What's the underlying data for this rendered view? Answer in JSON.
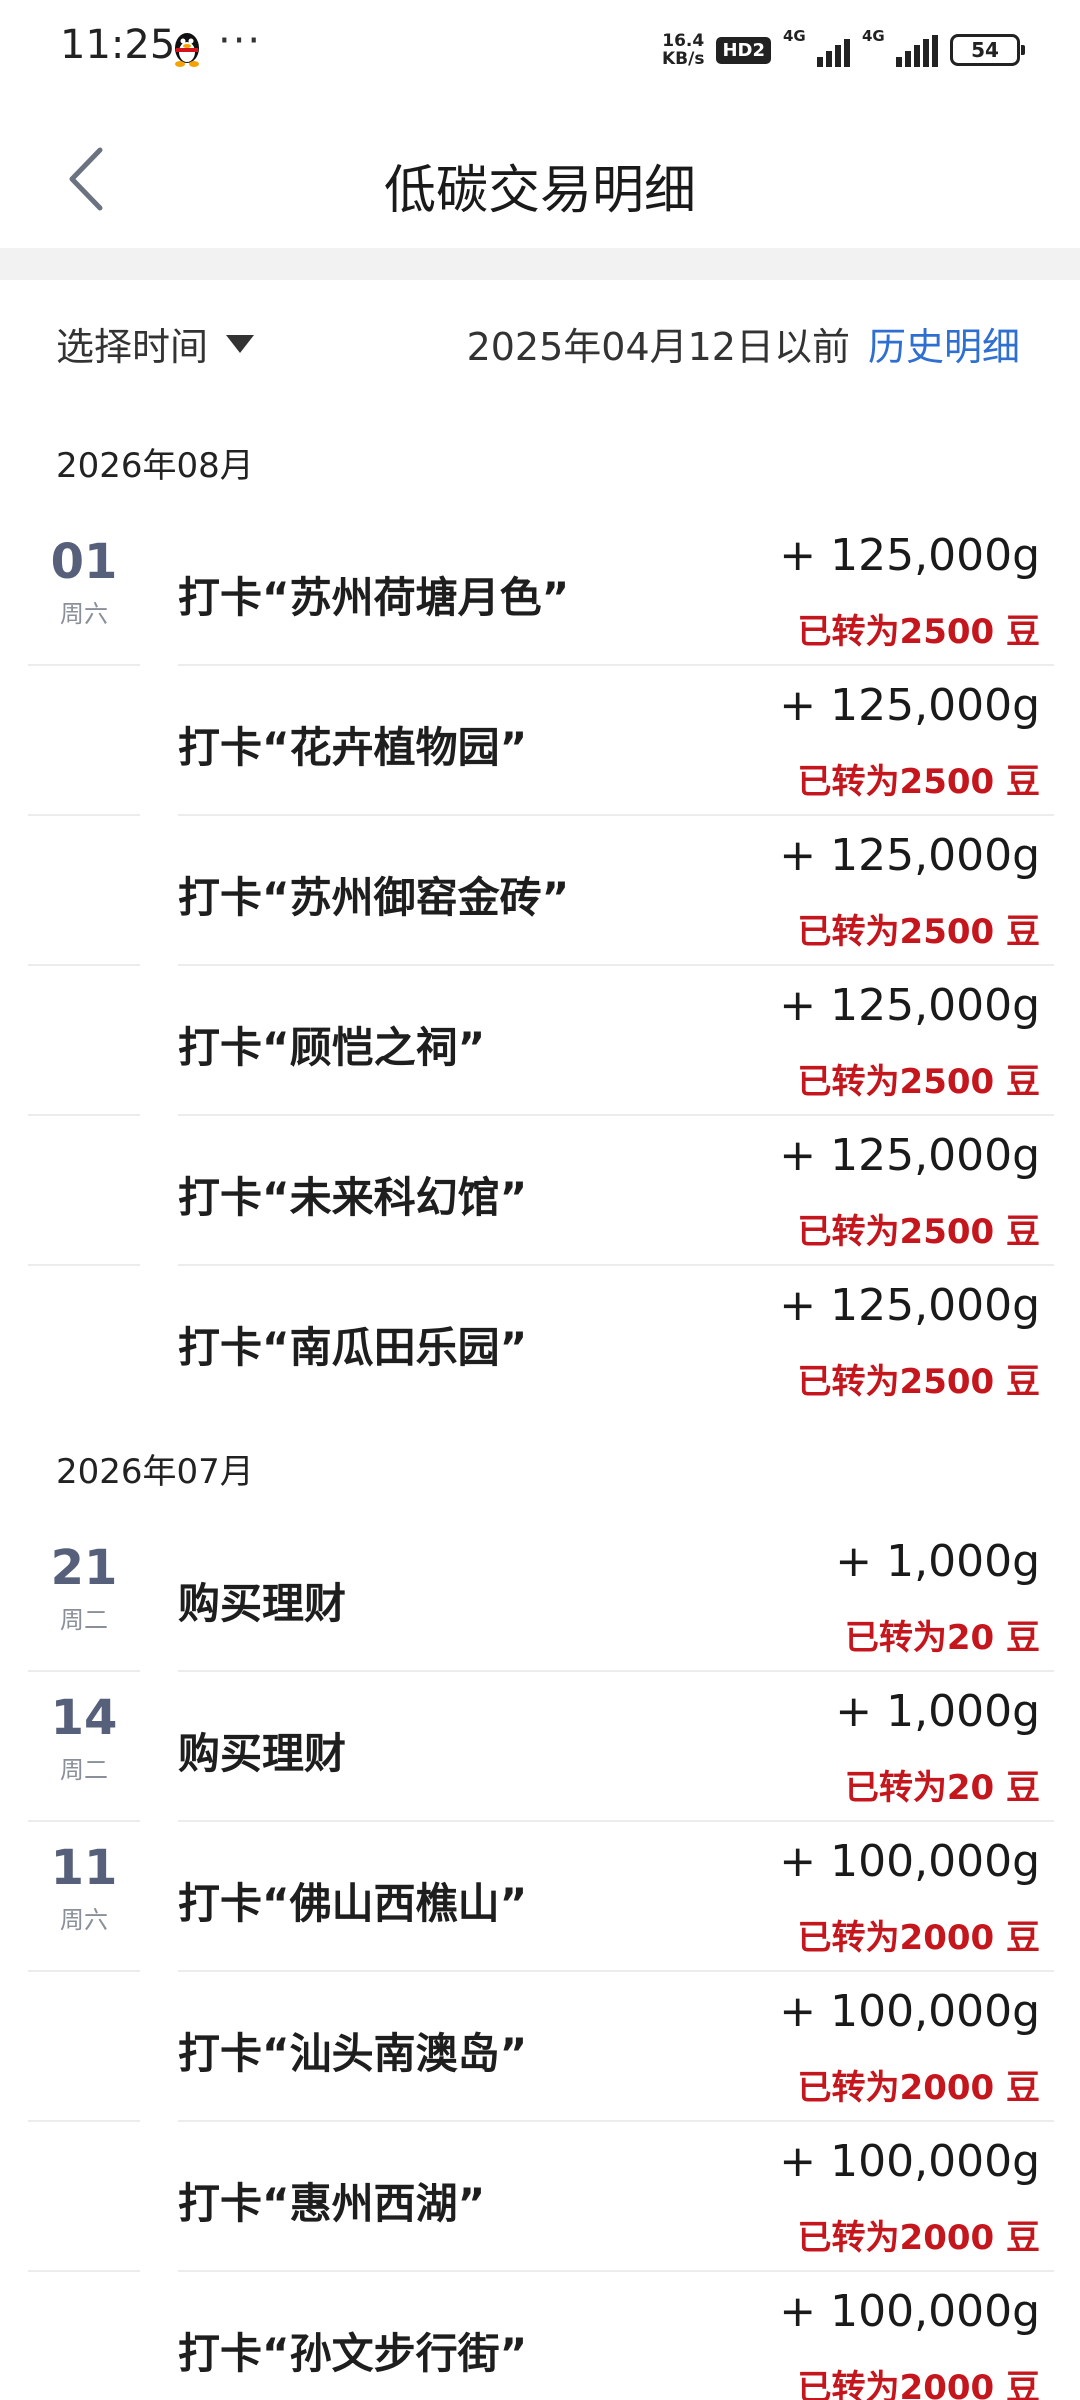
{
  "status_bar": {
    "time": "11:25",
    "speed_value": "16.4",
    "speed_unit": "KB/s",
    "hd_badge": "HD2",
    "network1": "4G",
    "network2": "4G",
    "battery": "54",
    "more": "···"
  },
  "nav": {
    "title": "低碳交易明细",
    "back_icon": "chevron-left-icon"
  },
  "filter": {
    "select_label": "选择时间",
    "date_text": "2025年04月12日以前",
    "history_link": "历史明细"
  },
  "colors": {
    "accent_link": "#2e6fd1",
    "converted_red": "#c4161c",
    "date_number": "#56607a"
  },
  "months": [
    {
      "label": "2026年08月",
      "entries": [
        {
          "day": "01",
          "week": "周六",
          "title": "打卡“苏州荷塘月色”",
          "amount": "+ 125,000g",
          "converted": "已转为2500 豆"
        },
        {
          "day": "",
          "week": "",
          "title": "打卡“花卉植物园”",
          "amount": "+ 125,000g",
          "converted": "已转为2500 豆"
        },
        {
          "day": "",
          "week": "",
          "title": "打卡“苏州御窑金砖”",
          "amount": "+ 125,000g",
          "converted": "已转为2500 豆"
        },
        {
          "day": "",
          "week": "",
          "title": "打卡“顾恺之祠”",
          "amount": "+ 125,000g",
          "converted": "已转为2500 豆"
        },
        {
          "day": "",
          "week": "",
          "title": "打卡“未来科幻馆”",
          "amount": "+ 125,000g",
          "converted": "已转为2500 豆"
        },
        {
          "day": "",
          "week": "",
          "title": "打卡“南瓜田乐园”",
          "amount": "+ 125,000g",
          "converted": "已转为2500 豆"
        }
      ]
    },
    {
      "label": "2026年07月",
      "entries": [
        {
          "day": "21",
          "week": "周二",
          "title": "购买理财",
          "amount": "+ 1,000g",
          "converted": "已转为20 豆"
        },
        {
          "day": "14",
          "week": "周二",
          "title": "购买理财",
          "amount": "+ 1,000g",
          "converted": "已转为20 豆"
        },
        {
          "day": "11",
          "week": "周六",
          "title": "打卡“佛山西樵山”",
          "amount": "+ 100,000g",
          "converted": "已转为2000 豆"
        },
        {
          "day": "",
          "week": "",
          "title": "打卡“汕头南澳岛”",
          "amount": "+ 100,000g",
          "converted": "已转为2000 豆"
        },
        {
          "day": "",
          "week": "",
          "title": "打卡“惠州西湖”",
          "amount": "+ 100,000g",
          "converted": "已转为2000 豆"
        },
        {
          "day": "",
          "week": "",
          "title": "打卡“孙文步行街”",
          "amount": "+ 100,000g",
          "converted": "已转为2000 豆"
        }
      ]
    }
  ]
}
